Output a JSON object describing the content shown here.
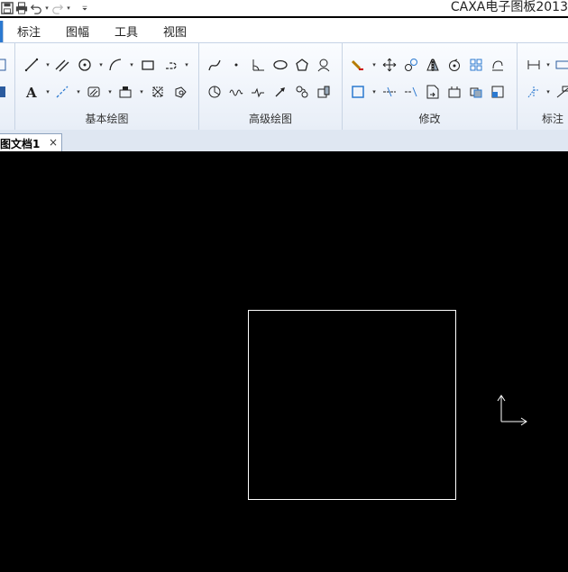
{
  "window": {
    "title": "CAXA电子图板2013"
  },
  "quick_access": [
    {
      "icon": "save-icon"
    },
    {
      "icon": "print-icon"
    },
    {
      "icon": "undo-icon"
    },
    {
      "icon": "redo-icon"
    },
    {
      "icon": "customize-icon"
    }
  ],
  "menu": {
    "items": [
      "标注",
      "图幅",
      "工具",
      "视图"
    ]
  },
  "ribbon": {
    "groups": [
      {
        "label": "基本绘图"
      },
      {
        "label": "高级绘图"
      },
      {
        "label": "修改"
      },
      {
        "label": "标注"
      }
    ]
  },
  "document_tab": {
    "label": "图文档1",
    "close": "×"
  },
  "colors": {
    "canvas": "#000000",
    "drawing_line": "#ffffff",
    "ribbon_bg": "#eaf0f8",
    "accent": "#2b79d0"
  }
}
